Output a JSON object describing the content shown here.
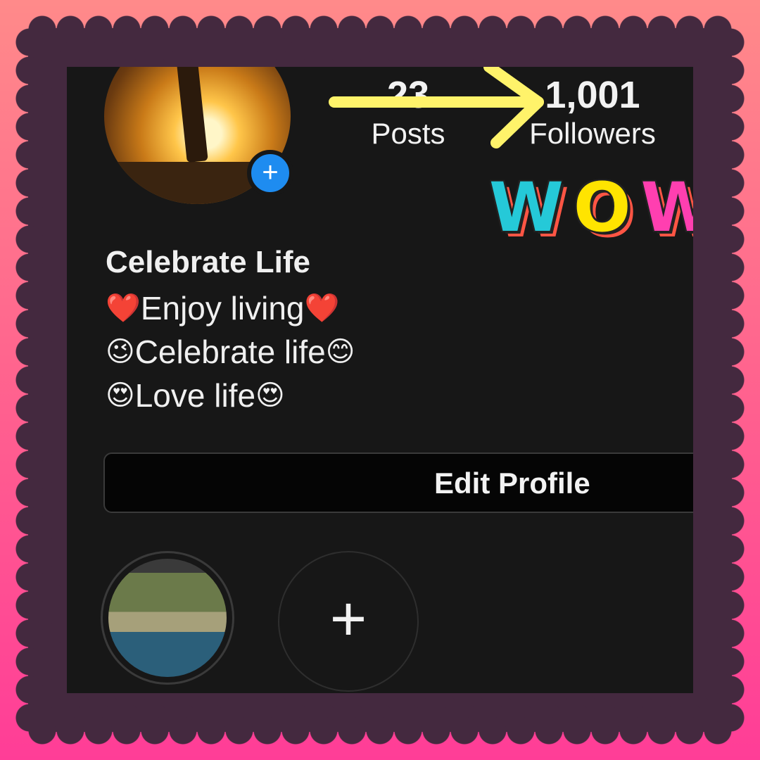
{
  "profile": {
    "stats": {
      "posts": {
        "value": "23",
        "label": "Posts"
      },
      "followers": {
        "value": "1,001",
        "label": "Followers"
      }
    },
    "avatar_add_icon": "+",
    "bio": {
      "name": "Celebrate Life",
      "lines": [
        {
          "prefix": "❤️",
          "text": "Enjoy living",
          "suffix": "❤️"
        },
        {
          "prefix": "😉",
          "text": "Celebrate life",
          "suffix": "😊"
        },
        {
          "prefix": "😍",
          "text": "Love life",
          "suffix": "😍"
        }
      ]
    },
    "edit_profile_label": "Edit Profile",
    "new_highlight_icon": "+"
  },
  "overlay": {
    "wow": [
      "W",
      "O",
      "W"
    ],
    "arrow_color": "#fff36a"
  }
}
